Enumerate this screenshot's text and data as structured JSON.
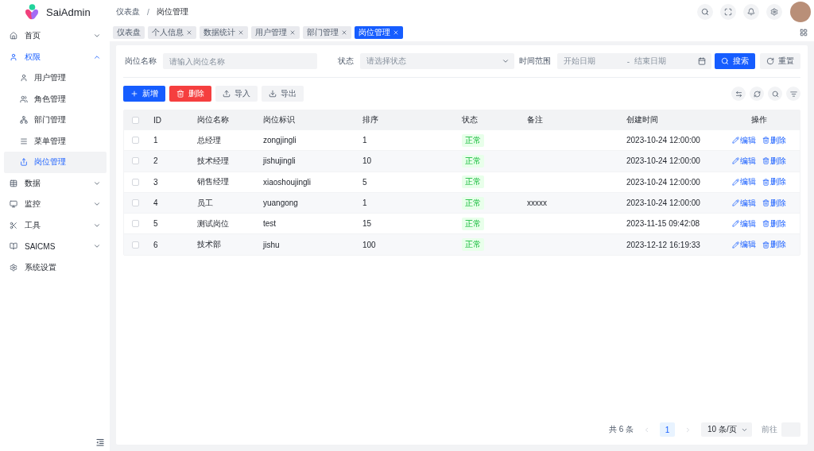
{
  "app": {
    "name": "SaiAdmin"
  },
  "breadcrumb": {
    "items": [
      "仪表盘",
      "岗位管理"
    ],
    "separator": "/"
  },
  "sidebar": {
    "items": [
      {
        "label": "首页",
        "kind": "group",
        "selected": false,
        "expanded": false
      },
      {
        "label": "权限",
        "kind": "group",
        "selected": true,
        "expanded": true,
        "children": [
          {
            "label": "用户管理",
            "selected": false
          },
          {
            "label": "角色管理",
            "selected": false
          },
          {
            "label": "部门管理",
            "selected": false
          },
          {
            "label": "菜单管理",
            "selected": false
          },
          {
            "label": "岗位管理",
            "selected": true
          }
        ]
      },
      {
        "label": "数据",
        "kind": "group",
        "selected": false,
        "expanded": false
      },
      {
        "label": "监控",
        "kind": "group",
        "selected": false,
        "expanded": false
      },
      {
        "label": "工具",
        "kind": "group",
        "selected": false,
        "expanded": false
      },
      {
        "label": "SAICMS",
        "kind": "group",
        "selected": false,
        "expanded": false
      },
      {
        "label": "系统设置",
        "kind": "link",
        "selected": false
      }
    ]
  },
  "tabs": [
    {
      "label": "仪表盘",
      "closable": false,
      "selected": false
    },
    {
      "label": "个人信息",
      "closable": true,
      "selected": false
    },
    {
      "label": "数据统计",
      "closable": true,
      "selected": false
    },
    {
      "label": "用户管理",
      "closable": true,
      "selected": false
    },
    {
      "label": "部门管理",
      "closable": true,
      "selected": false
    },
    {
      "label": "岗位管理",
      "closable": true,
      "selected": true
    }
  ],
  "search_form": {
    "fields": [
      {
        "kind": "input",
        "label": "岗位名称",
        "placeholder": "请输入岗位名称"
      },
      {
        "kind": "select",
        "label": "状态",
        "placeholder": "请选择状态"
      },
      {
        "kind": "date_range",
        "label": "时间范围",
        "start_placeholder": "开始日期",
        "separator": "-",
        "end_placeholder": "结束日期"
      }
    ],
    "buttons": [
      {
        "label": "搜索",
        "kind": "primary"
      },
      {
        "label": "重置",
        "kind": "default"
      }
    ]
  },
  "toolbar": {
    "buttons": [
      {
        "label": "新增",
        "kind": "primary"
      },
      {
        "label": "删除",
        "kind": "danger"
      },
      {
        "label": "导入",
        "kind": "default"
      },
      {
        "label": "导出",
        "kind": "default"
      }
    ]
  },
  "table": {
    "header_checked": false,
    "columns": [
      "ID",
      "岗位名称",
      "岗位标识",
      "排序",
      "状态",
      "备注",
      "创建时间",
      "操作"
    ],
    "rows": [
      {
        "checked": false,
        "id": "1",
        "name": "总经理",
        "code": "zongjingli",
        "sort": "1",
        "status": "正常",
        "created": "2023-10-24 12:00:00",
        "actions": [
          "编辑",
          "删除"
        ]
      },
      {
        "checked": false,
        "id": "2",
        "name": "技术经理",
        "code": "jishujingli",
        "sort": "10",
        "status": "正常",
        "created": "2023-10-24 12:00:00",
        "actions": [
          "编辑",
          "删除"
        ]
      },
      {
        "checked": false,
        "id": "3",
        "name": "销售经理",
        "code": "xiaoshoujingli",
        "sort": "5",
        "status": "正常",
        "created": "2023-10-24 12:00:00",
        "actions": [
          "编辑",
          "删除"
        ]
      },
      {
        "checked": false,
        "id": "4",
        "name": "员工",
        "code": "yuangong",
        "sort": "1",
        "status": "正常",
        "remark": "xxxxx",
        "created": "2023-10-24 12:00:00",
        "actions": [
          "编辑",
          "删除"
        ]
      },
      {
        "checked": false,
        "id": "5",
        "name": "测试岗位",
        "code": "test",
        "sort": "15",
        "status": "正常",
        "created": "2023-11-15 09:42:08",
        "actions": [
          "编辑",
          "删除"
        ]
      },
      {
        "checked": false,
        "id": "6",
        "name": "技术部",
        "code": "jishu",
        "sort": "100",
        "status": "正常",
        "created": "2023-12-12 16:19:33",
        "actions": [
          "编辑",
          "删除"
        ]
      }
    ]
  },
  "pagination": {
    "total": "共 6 条",
    "prev_disabled": true,
    "pages": [
      {
        "label": "1",
        "selected": true
      }
    ],
    "next_disabled": true,
    "page_size": "10 条/页",
    "goto_label": "前往"
  }
}
